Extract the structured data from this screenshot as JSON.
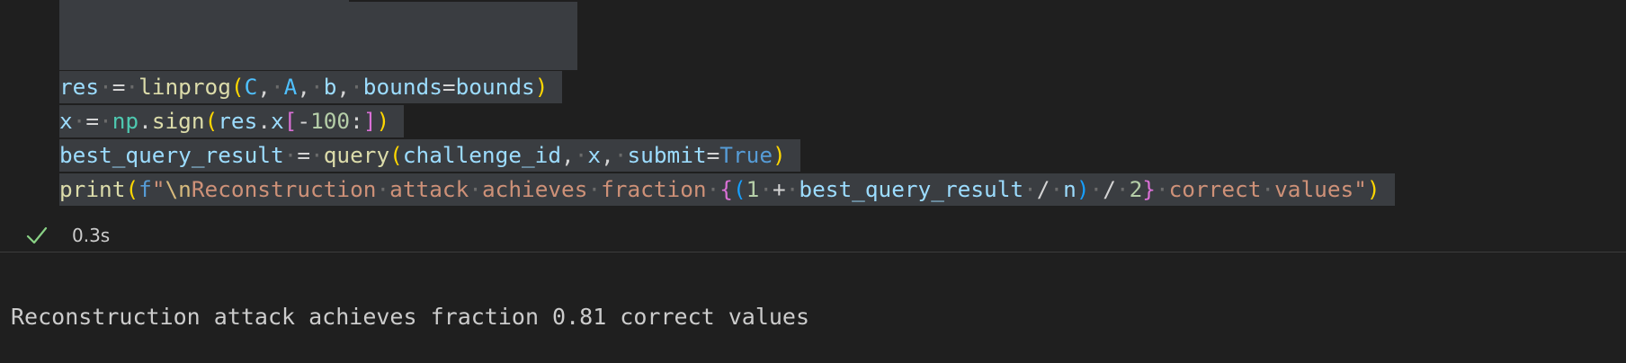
{
  "cell": {
    "code_lines": [
      "res = linprog(C, A, b, bounds=bounds)",
      "x = np.sign(res.x[-100:])",
      "best_query_result = query(challenge_id, x, submit=True)",
      "print(f\"\\nReconstruction attack achieves fraction {(1 + best_query_result / n) / 2} correct values\")"
    ],
    "status": {
      "icon": "check-icon",
      "color": "#89d185",
      "duration": "0.3s"
    },
    "output": "Reconstruction attack achieves fraction 0.81 correct values"
  }
}
